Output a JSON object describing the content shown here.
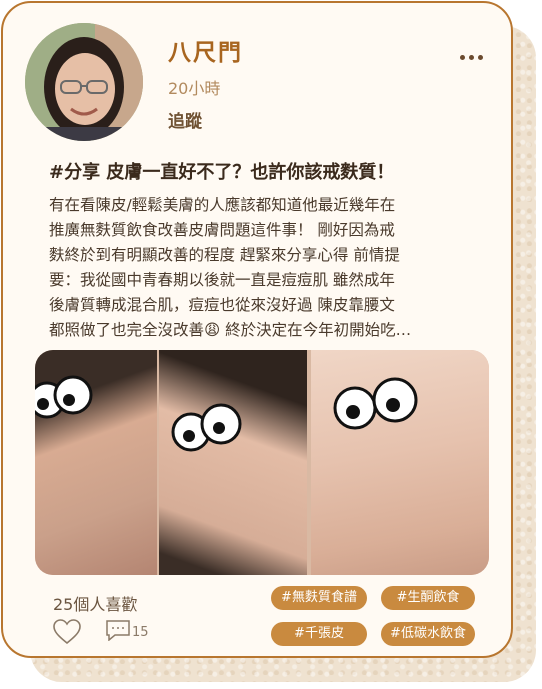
{
  "post": {
    "author": "八尺門",
    "time": "20小時",
    "follow_label": "追蹤",
    "title": "#分享 皮膚一直好不了？也許你該戒麩質！",
    "body": "有在看陳皮/輕鬆美膚的人應該都知道他最近幾年在\n推廣無麩質飲食改善皮膚問題這件事！ 剛好因為戒\n麩終於到有明顯改善的程度 趕緊來分享心得 前情提\n要：我從國中青春期以後就一直是痘痘肌 雖然成年\n後膚質轉成混合肌，痘痘也從來沒好過 陳皮靠腰文\n都照做了也完全沒改善😩 終於決定在今年初開始吃…",
    "likes": "25個人喜歡",
    "comment_count": "15",
    "tags": [
      "#無麩質食譜",
      "#生酮飲食",
      "#千張皮",
      "#低碳水飲食"
    ]
  },
  "colors": {
    "accent": "#a8651f",
    "border": "#b8762f",
    "tag_bg": "#c98a3f",
    "card_bg": "#fffaf3"
  },
  "icons": {
    "more": "more-icon",
    "like": "heart-icon",
    "comment": "comment-icon"
  }
}
